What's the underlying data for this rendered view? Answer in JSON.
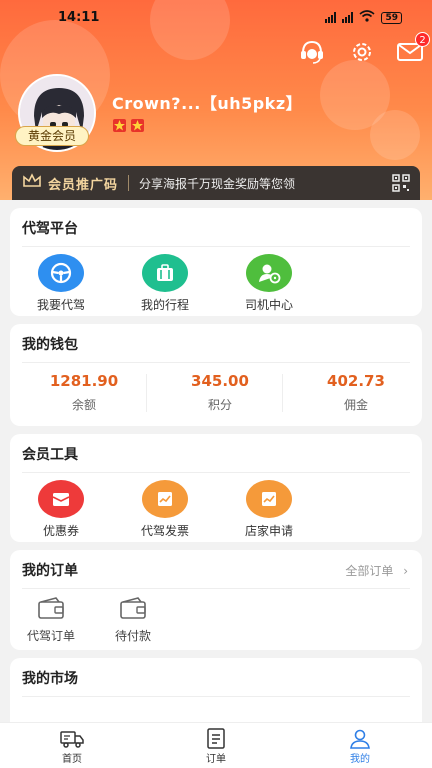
{
  "status_bar": {
    "time": "14:11",
    "battery": "59"
  },
  "header": {
    "message_badge": "2",
    "member_level": "黄金会员",
    "username": "Crown?...【uh5pkz】",
    "icons": [
      "customer-service-icon",
      "gear-icon",
      "mail-icon"
    ]
  },
  "promo": {
    "title": "会员推广码",
    "description": "分享海报千万现金奖励等您领",
    "icon": "qr-code-icon"
  },
  "driving_platform": {
    "title": "代驾平台",
    "items": [
      {
        "label": "我要代驾",
        "icon": "steering-wheel-icon",
        "color": "#2e8ff0"
      },
      {
        "label": "我的行程",
        "icon": "briefcase-icon",
        "color": "#1fbf8f"
      },
      {
        "label": "司机中心",
        "icon": "driver-icon",
        "color": "#4fbe3d"
      }
    ]
  },
  "wallet": {
    "title": "我的钱包",
    "items": [
      {
        "value": "1281.90",
        "label": "余额"
      },
      {
        "value": "345.00",
        "label": "积分"
      },
      {
        "value": "402.73",
        "label": "佣金"
      }
    ]
  },
  "member_tools": {
    "title": "会员工具",
    "items": [
      {
        "label": "优惠券",
        "icon": "coupon-icon",
        "color": "#ee3a3a"
      },
      {
        "label": "代驾发票",
        "icon": "invoice-icon",
        "color": "#f59a3a"
      },
      {
        "label": "店家申请",
        "icon": "store-apply-icon",
        "color": "#f59a3a"
      }
    ]
  },
  "orders": {
    "title": "我的订单",
    "all_label": "全部订单",
    "items": [
      {
        "label": "代驾订单",
        "icon": "wallet-icon"
      },
      {
        "label": "待付款",
        "icon": "wallet-icon"
      }
    ]
  },
  "market": {
    "title": "我的市场"
  },
  "tabbar": {
    "items": [
      {
        "label": "首页",
        "icon": "truck-icon"
      },
      {
        "label": "订单",
        "icon": "document-icon"
      },
      {
        "label": "我的",
        "icon": "user-icon"
      }
    ],
    "active_color": "#2f7fe6"
  },
  "colors": {
    "accent": "#ff6a3d",
    "value_orange": "#e2601f"
  }
}
